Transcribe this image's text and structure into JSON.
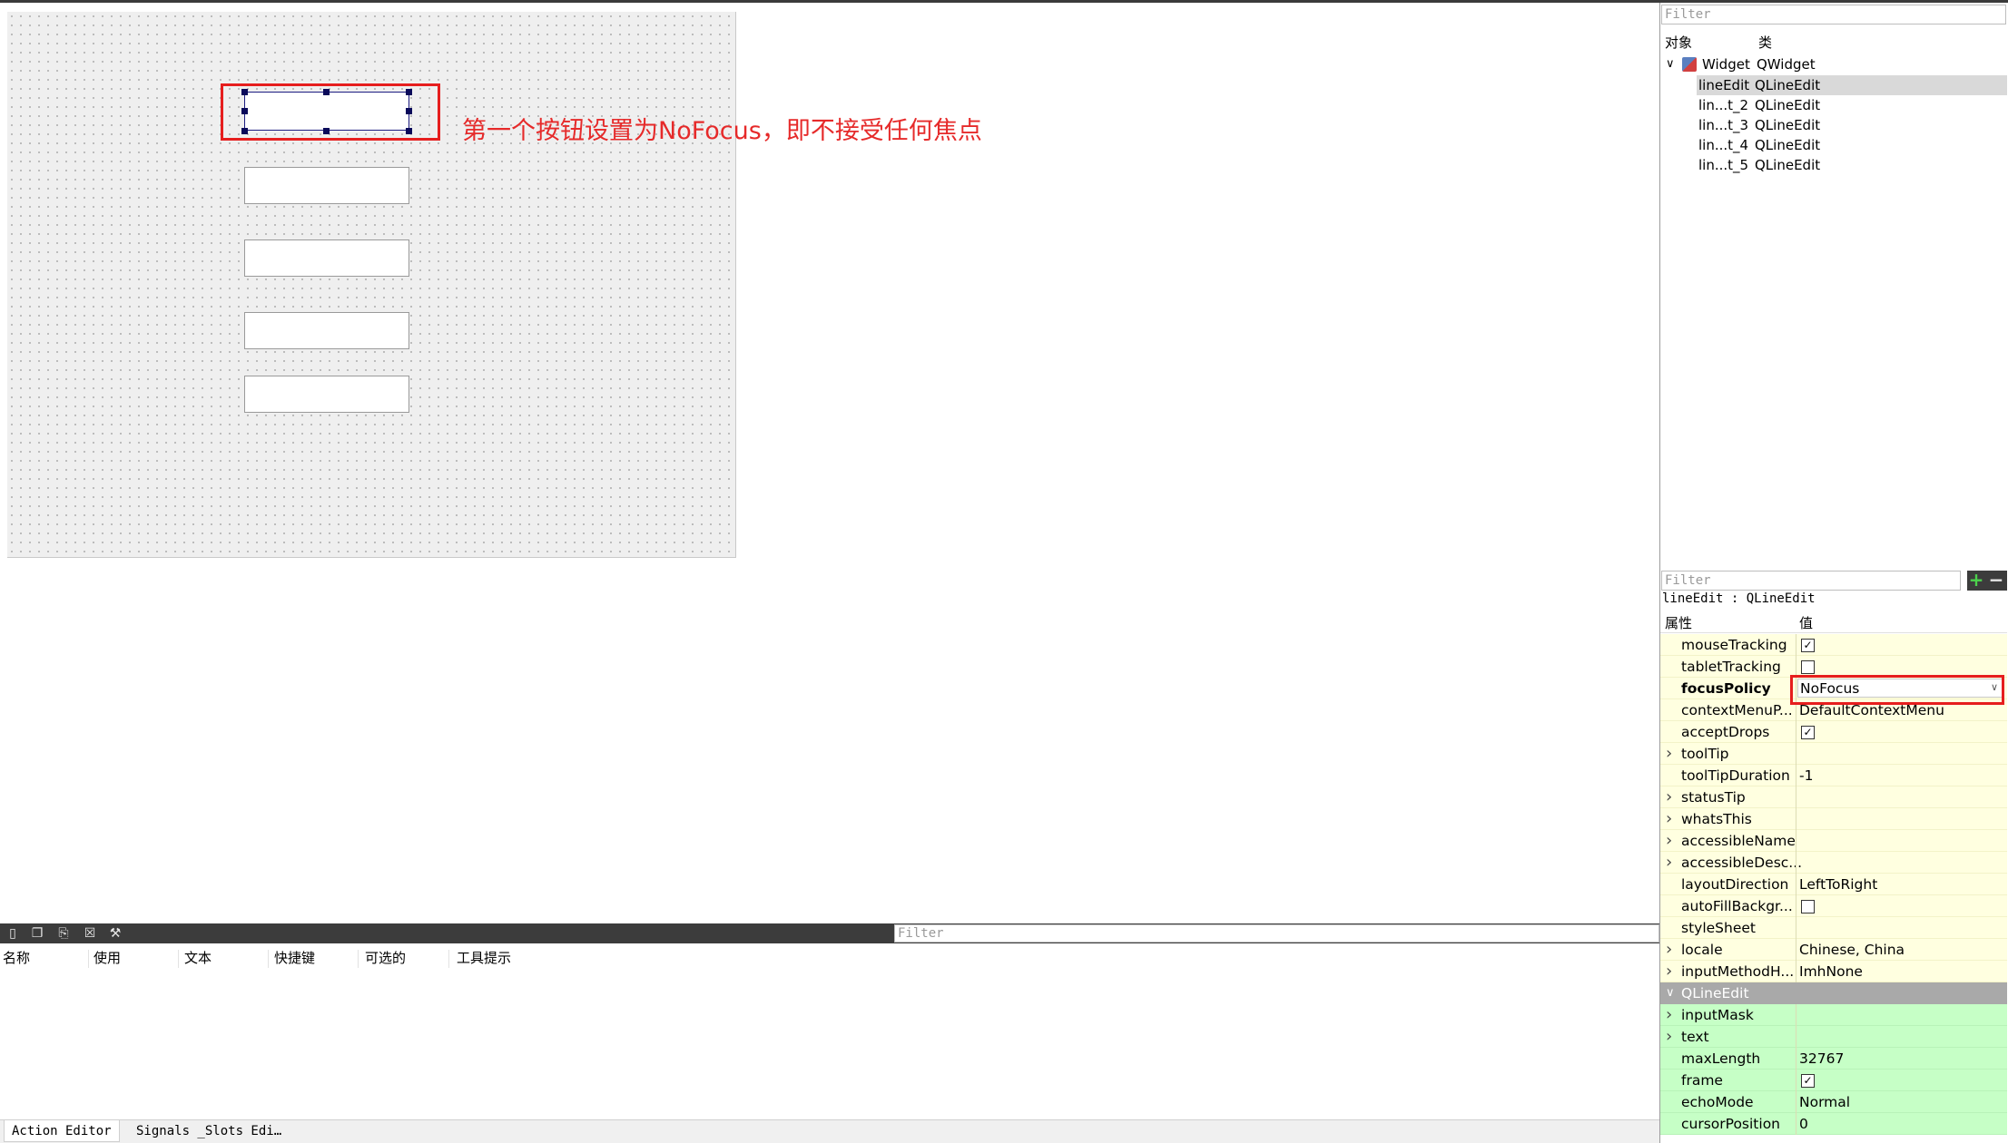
{
  "annotations": {
    "canvas_note": "第一个按钮设置为NoFocus，即不接受任何焦点"
  },
  "object_inspector": {
    "filter_placeholder": "Filter",
    "headers": {
      "object": "对象",
      "class": "类"
    },
    "root": {
      "name": "Widget",
      "class": "QWidget"
    },
    "children": [
      {
        "name": "lineEdit",
        "class": "QLineEdit",
        "selected": true
      },
      {
        "name": "lin...t_2",
        "class": "QLineEdit",
        "selected": false
      },
      {
        "name": "lin...t_3",
        "class": "QLineEdit",
        "selected": false
      },
      {
        "name": "lin...t_4",
        "class": "QLineEdit",
        "selected": false
      },
      {
        "name": "lin...t_5",
        "class": "QLineEdit",
        "selected": false
      }
    ]
  },
  "property_editor": {
    "filter_placeholder": "Filter",
    "add_icon": "plus-icon",
    "remove_icon": "minus-icon",
    "object_label": "lineEdit : QLineEdit",
    "headers": {
      "property": "属性",
      "value": "值"
    },
    "rows": [
      {
        "name": "mouseTracking",
        "value": "",
        "checkbox": true,
        "checked": true,
        "expandable": false
      },
      {
        "name": "tabletTracking",
        "value": "",
        "checkbox": true,
        "checked": false,
        "expandable": false
      },
      {
        "name": "focusPolicy",
        "value": "NoFocus",
        "checkbox": false,
        "expandable": false,
        "bold": true,
        "combo": true
      },
      {
        "name": "contextMenuP...",
        "value": "DefaultContextMenu",
        "checkbox": false,
        "expandable": false
      },
      {
        "name": "acceptDrops",
        "value": "",
        "checkbox": true,
        "checked": true,
        "expandable": false
      },
      {
        "name": "toolTip",
        "value": "",
        "checkbox": false,
        "expandable": true
      },
      {
        "name": "toolTipDuration",
        "value": "-1",
        "checkbox": false,
        "expandable": false
      },
      {
        "name": "statusTip",
        "value": "",
        "checkbox": false,
        "expandable": true
      },
      {
        "name": "whatsThis",
        "value": "",
        "checkbox": false,
        "expandable": true
      },
      {
        "name": "accessibleName",
        "value": "",
        "checkbox": false,
        "expandable": true
      },
      {
        "name": "accessibleDesc...",
        "value": "",
        "checkbox": false,
        "expandable": true
      },
      {
        "name": "layoutDirection",
        "value": "LeftToRight",
        "checkbox": false,
        "expandable": false
      },
      {
        "name": "autoFillBackgr...",
        "value": "",
        "checkbox": true,
        "checked": false,
        "expandable": false
      },
      {
        "name": "styleSheet",
        "value": "",
        "checkbox": false,
        "expandable": false
      },
      {
        "name": "locale",
        "value": "Chinese, China",
        "checkbox": false,
        "expandable": true
      },
      {
        "name": "inputMethodH...",
        "value": "ImhNone",
        "checkbox": false,
        "expandable": true
      }
    ],
    "section": "QLineEdit",
    "section_rows": [
      {
        "name": "inputMask",
        "value": "",
        "checkbox": false,
        "expandable": true
      },
      {
        "name": "text",
        "value": "",
        "checkbox": false,
        "expandable": true
      },
      {
        "name": "maxLength",
        "value": "32767",
        "checkbox": false,
        "expandable": false
      },
      {
        "name": "frame",
        "value": "",
        "checkbox": true,
        "checked": true,
        "expandable": false
      },
      {
        "name": "echoMode",
        "value": "Normal",
        "checkbox": false,
        "expandable": false
      },
      {
        "name": "cursorPosition",
        "value": "0",
        "checkbox": false,
        "expandable": false
      }
    ]
  },
  "action_editor": {
    "filter_placeholder": "Filter",
    "toolbar_icons": [
      "new-action-icon",
      "copy-icon",
      "paste-icon",
      "delete-icon",
      "configure-icon"
    ],
    "columns": [
      "名称",
      "使用",
      "文本",
      "快捷键",
      "可选的",
      "工具提示"
    ]
  },
  "bottom_tabs": [
    "Action Editor",
    "Signals _Slots Edi…"
  ],
  "colors": {
    "annotation_red": "#e61e1e",
    "selected_row": "#d9d9d9",
    "qwidget_props": "#ffffe0",
    "qlineedit_props": "#c6ffc6"
  }
}
